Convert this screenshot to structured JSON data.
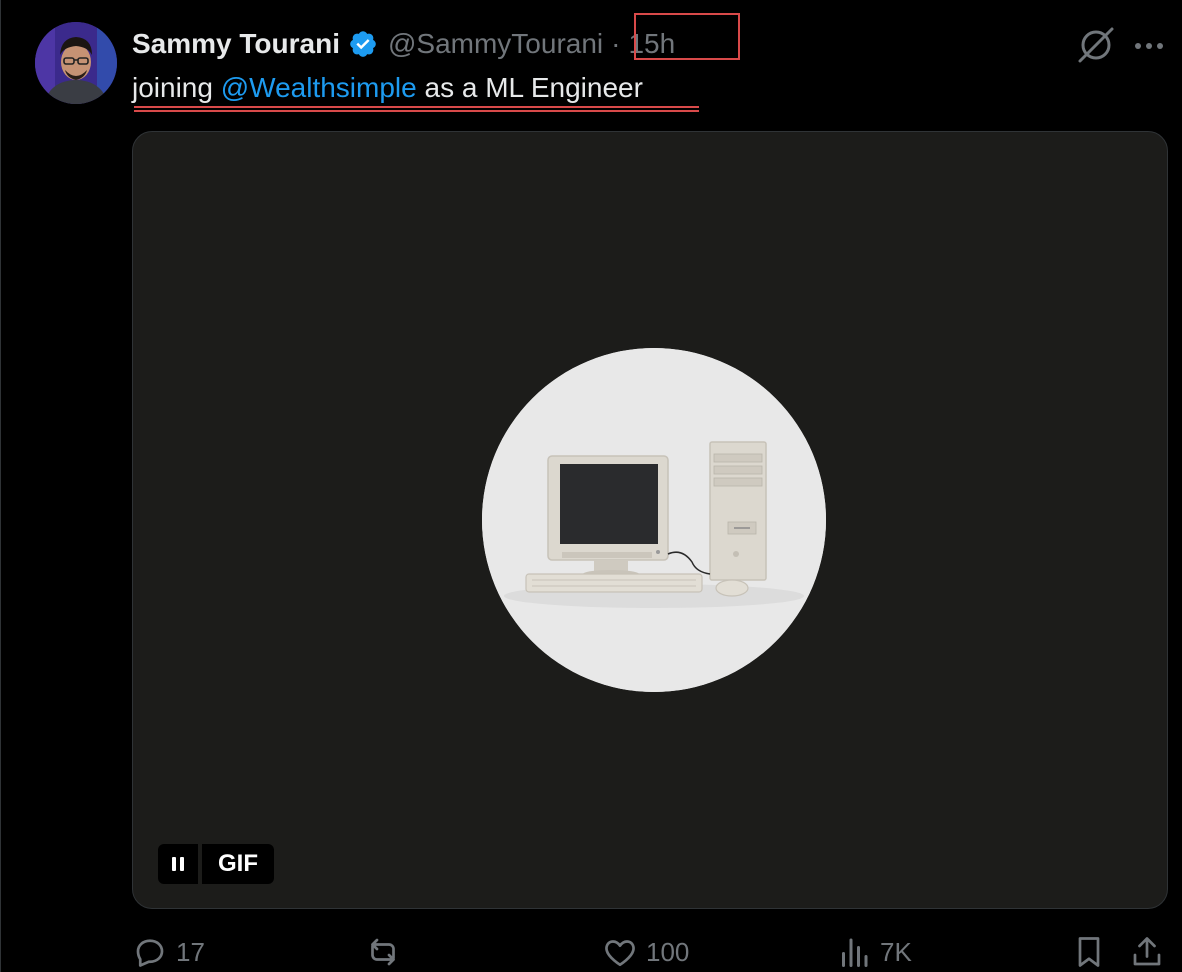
{
  "tweet": {
    "display_name": "Sammy Tourani",
    "handle": "@SammyTourani",
    "separator": "·",
    "time": "15h",
    "text_before": "joining ",
    "mention": "@Wealthsimple",
    "text_after": " as a ML Engineer",
    "verified": true,
    "avatar_icon": "user-avatar"
  },
  "media": {
    "type": "gif",
    "badge_label": "GIF",
    "control_icon": "pause-icon",
    "depicts": "retro-computer"
  },
  "actions": {
    "reply_count": "17",
    "repost_count": "",
    "like_count": "100",
    "views_count": "7K"
  },
  "colors": {
    "background": "#000000",
    "text": "#e7e9ea",
    "muted": "#71767b",
    "link": "#1d9bf0",
    "verified": "#1d9bf0",
    "annotation": "#d94a4a"
  }
}
